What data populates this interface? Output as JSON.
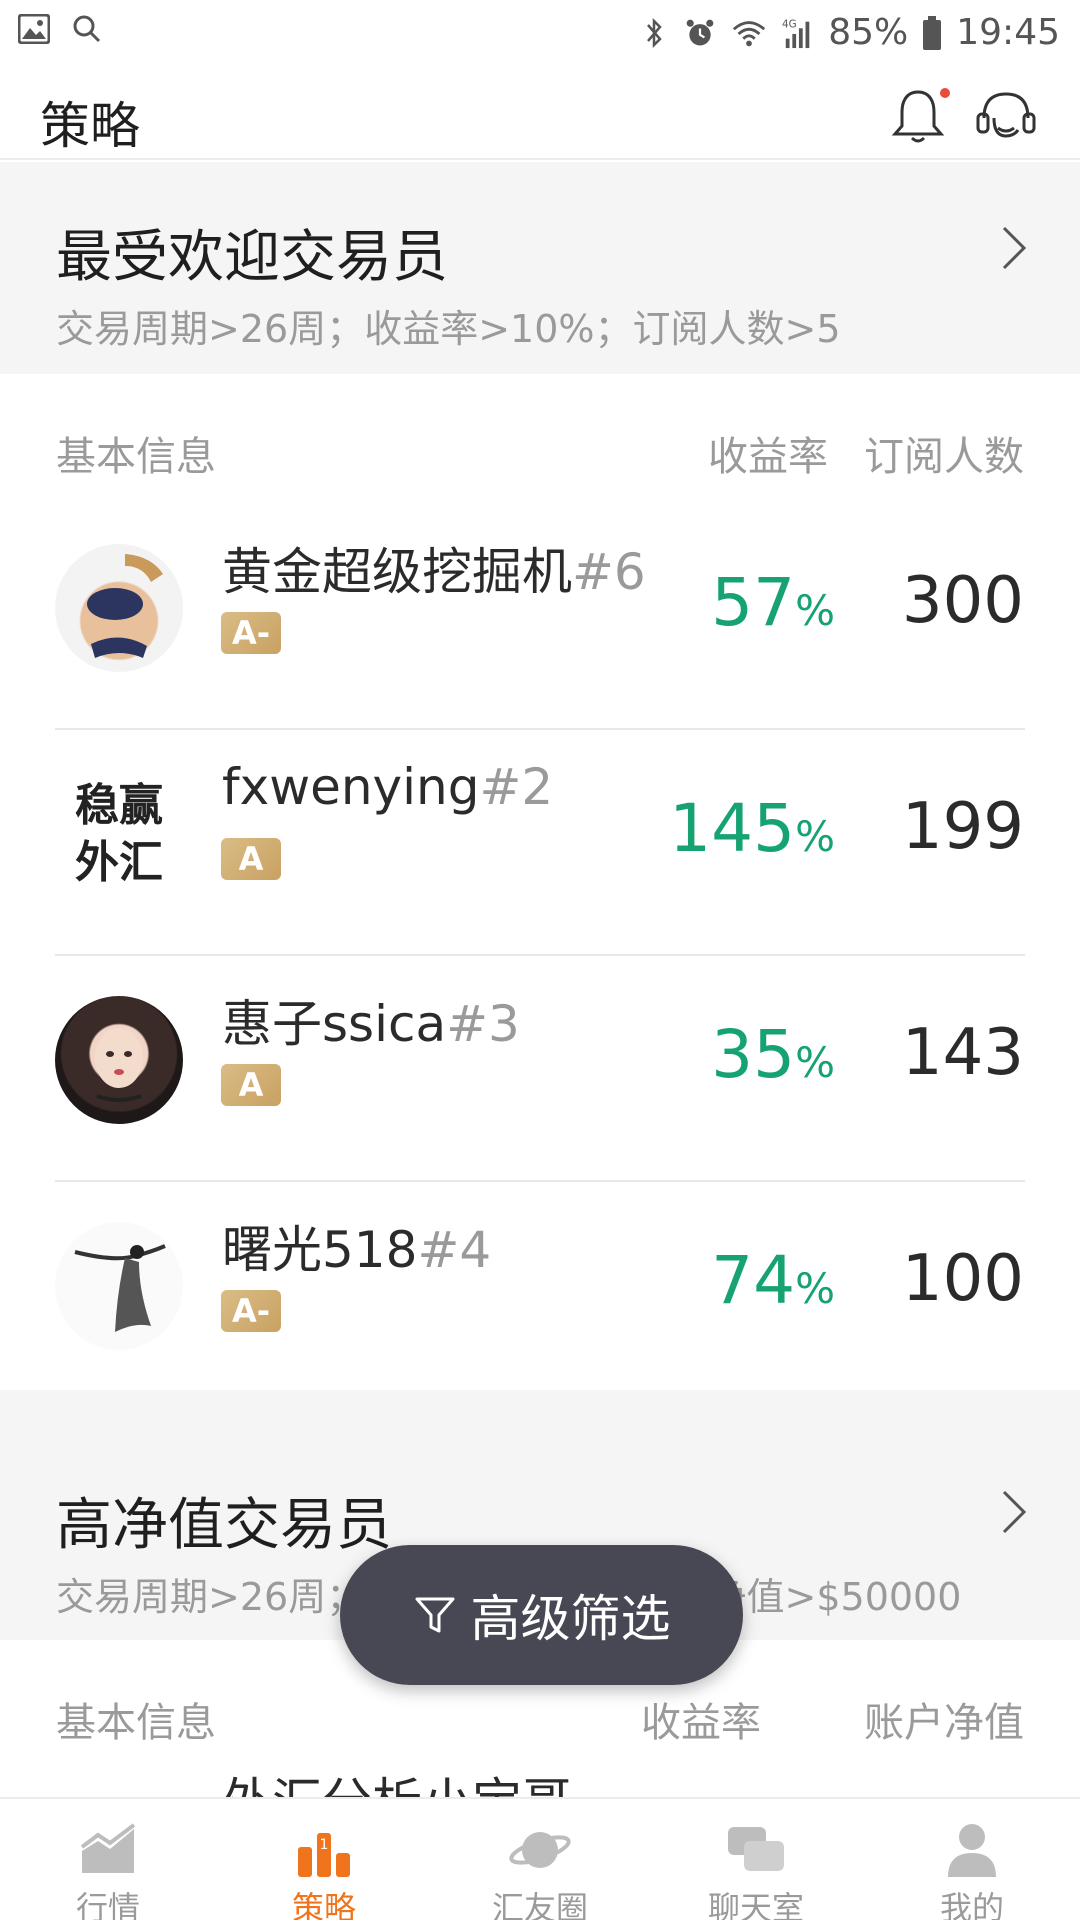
{
  "status_bar": {
    "battery": "85%",
    "time": "19:45",
    "network": "4G"
  },
  "header": {
    "title": "策略"
  },
  "popular": {
    "title": "最受欢迎交易员",
    "criteria": "交易周期>26周；收益率>10%；订阅人数>5",
    "columns": {
      "basic": "基本信息",
      "rate": "收益率",
      "subscribers": "订阅人数"
    },
    "traders": [
      {
        "name": "黄金超级挖掘机",
        "rank": "#6",
        "grade": "A-",
        "rate": "57",
        "subscribers": "300"
      },
      {
        "name": "fxwenying",
        "rank": "#2",
        "grade": "A",
        "rate": "145",
        "subscribers": "199"
      },
      {
        "name": "惠子ssica",
        "rank": "#3",
        "grade": "A",
        "rate": "35",
        "subscribers": "143"
      },
      {
        "name": "曙光518",
        "rank": "#4",
        "grade": "A-",
        "rate": "74",
        "subscribers": "100"
      }
    ],
    "avatar_text": [
      "稳赢",
      "外汇"
    ]
  },
  "high_net": {
    "title": "高净值交易员",
    "criteria": "交易周期>26周；收益率>10%；账户净值>$50000",
    "columns": {
      "basic": "基本信息",
      "rate": "收益率",
      "equity": "账户净值"
    },
    "partial_trader": "外汇分析小宝哥"
  },
  "percent_sign": "%",
  "filter_button": {
    "label": "高级筛选",
    "icon": "funnel-icon"
  },
  "bottom_nav": [
    {
      "label": "行情",
      "icon": "market-chart-icon",
      "active": false
    },
    {
      "label": "策略",
      "icon": "podium-icon",
      "active": true
    },
    {
      "label": "汇友圈",
      "icon": "planet-icon",
      "active": false
    },
    {
      "label": "聊天室",
      "icon": "chat-bubbles-icon",
      "active": false
    },
    {
      "label": "我的",
      "icon": "person-icon",
      "active": false
    }
  ],
  "colors": {
    "accent": "#f0741e",
    "profit_green": "#16a371",
    "badge_gold": "#c9a162",
    "fab_bg": "#474853"
  }
}
